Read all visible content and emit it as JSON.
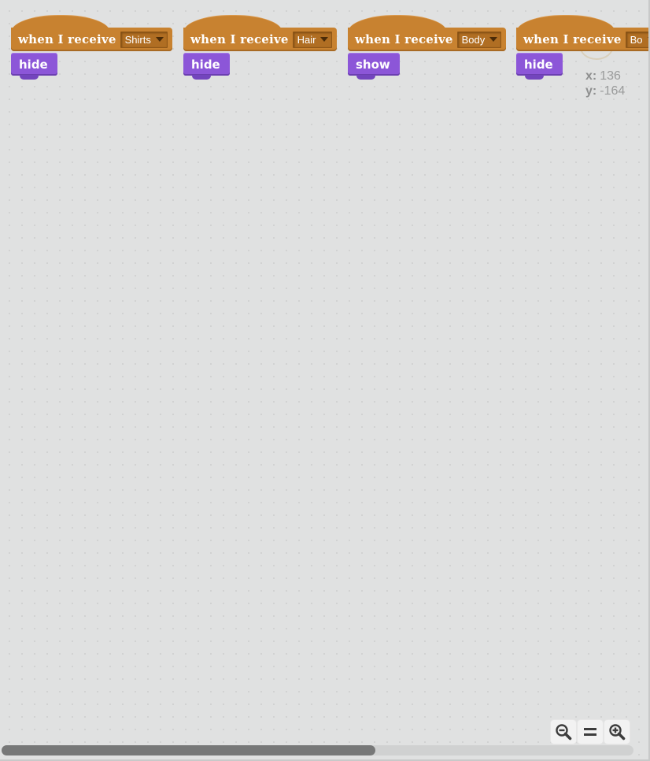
{
  "scripts": [
    {
      "hat_label": "when I receive",
      "message": "Shirts",
      "block": "hide"
    },
    {
      "hat_label": "when I receive",
      "message": "Hair",
      "block": "hide"
    },
    {
      "hat_label": "when I receive",
      "message": "Body",
      "block": "show"
    },
    {
      "hat_label": "when I receive",
      "message": "Bo",
      "block": "hide"
    }
  ],
  "coords": {
    "x_label": "x:",
    "x_value": "136",
    "y_label": "y:",
    "y_value": "-164"
  },
  "zoom": {
    "zoom_out_icon": "zoom-out-icon",
    "reset_icon": "zoom-reset-icon",
    "zoom_in_icon": "zoom-in-icon"
  },
  "colors": {
    "events": "#c88230",
    "looks": "#8c56d8",
    "workspace": "#e0e1e1"
  }
}
